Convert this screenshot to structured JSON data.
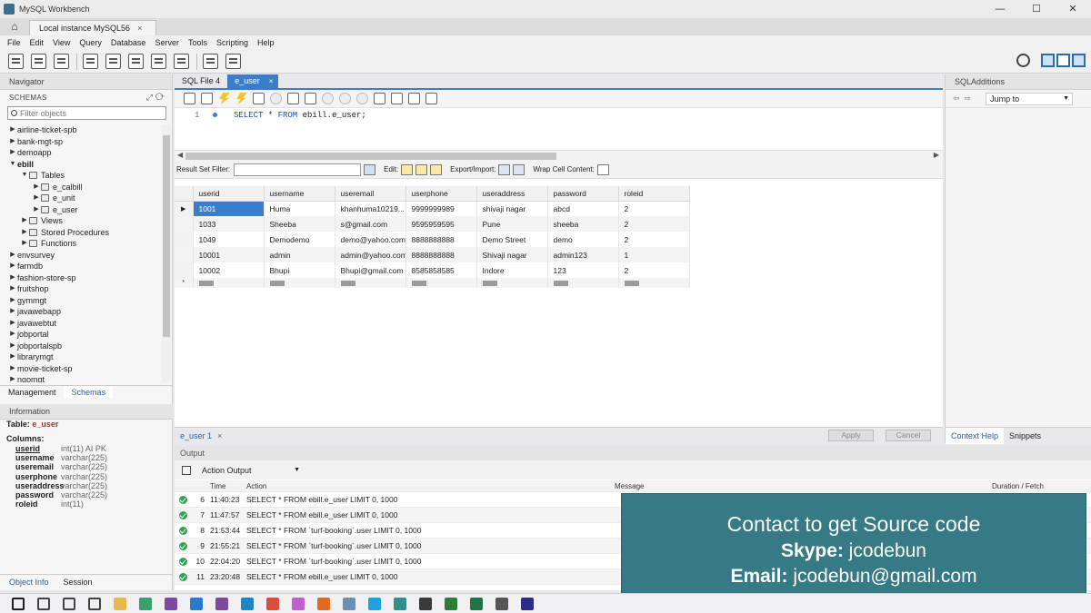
{
  "window": {
    "title": "MySQL Workbench",
    "minimize": "—",
    "maximize": "☐",
    "close": "✕"
  },
  "connection_tab": {
    "home": "⌂",
    "label": "Local instance MySQL56",
    "close": "×"
  },
  "menu": [
    "File",
    "Edit",
    "View",
    "Query",
    "Database",
    "Server",
    "Tools",
    "Scripting",
    "Help"
  ],
  "navigator": {
    "title": "Navigator",
    "schemas_label": "SCHEMAS",
    "filter_placeholder": "Filter objects",
    "tree": [
      {
        "label": "airline-ticket-spb",
        "level": 0,
        "expanded": false
      },
      {
        "label": "bank-mgt-sp",
        "level": 0,
        "expanded": false
      },
      {
        "label": "demoapp",
        "level": 0,
        "expanded": false
      },
      {
        "label": "ebill",
        "level": 0,
        "expanded": true,
        "bold": true
      },
      {
        "label": "Tables",
        "level": 1,
        "expanded": true
      },
      {
        "label": "e_calbill",
        "level": 2,
        "expanded": false
      },
      {
        "label": "e_unit",
        "level": 2,
        "expanded": false
      },
      {
        "label": "e_user",
        "level": 2,
        "expanded": false
      },
      {
        "label": "Views",
        "level": 1,
        "expanded": false
      },
      {
        "label": "Stored Procedures",
        "level": 1,
        "expanded": false
      },
      {
        "label": "Functions",
        "level": 1,
        "expanded": false
      },
      {
        "label": "envsurvey",
        "level": 0,
        "expanded": false
      },
      {
        "label": "farmdb",
        "level": 0,
        "expanded": false
      },
      {
        "label": "fashion-store-sp",
        "level": 0,
        "expanded": false
      },
      {
        "label": "fruitshop",
        "level": 0,
        "expanded": false
      },
      {
        "label": "gymmgt",
        "level": 0,
        "expanded": false
      },
      {
        "label": "javawebapp",
        "level": 0,
        "expanded": false
      },
      {
        "label": "javawebtut",
        "level": 0,
        "expanded": false
      },
      {
        "label": "jobportal",
        "level": 0,
        "expanded": false
      },
      {
        "label": "jobportalspb",
        "level": 0,
        "expanded": false
      },
      {
        "label": "librarymgt",
        "level": 0,
        "expanded": false
      },
      {
        "label": "movie-ticket-sp",
        "level": 0,
        "expanded": false
      },
      {
        "label": "ngomgt",
        "level": 0,
        "expanded": false
      }
    ],
    "tabs": [
      "Management",
      "Schemas"
    ],
    "active_tab": "Schemas"
  },
  "information": {
    "title": "Information",
    "table_label": "Table:",
    "table_name": "e_user",
    "columns_label": "Columns:",
    "columns": [
      {
        "name": "userid",
        "type": "int(11) AI PK"
      },
      {
        "name": "username",
        "type": "varchar(225)"
      },
      {
        "name": "useremail",
        "type": "varchar(225)"
      },
      {
        "name": "userphone",
        "type": "varchar(225)"
      },
      {
        "name": "useraddress",
        "type": "varchar(225)"
      },
      {
        "name": "password",
        "type": "varchar(225)"
      },
      {
        "name": "roleid",
        "type": "int(11)"
      }
    ],
    "bottom_tabs": [
      "Object Info",
      "Session"
    ]
  },
  "editor": {
    "tabs": [
      {
        "label": "SQL File 4",
        "active": false
      },
      {
        "label": "e_user",
        "active": true,
        "close": "×"
      }
    ],
    "line_number": "1",
    "sql_keyword1": "SELECT",
    "sql_rest1": " * ",
    "sql_keyword2": "FROM",
    "sql_rest2": " ebill.e_user;"
  },
  "result_bar": {
    "filter_label": "Result Set Filter:",
    "edit_label": "Edit:",
    "export_label": "Export/Import:",
    "wrap_label": "Wrap Cell Content:"
  },
  "result_grid": {
    "columns": [
      "userid",
      "username",
      "useremail",
      "userphone",
      "useraddress",
      "password",
      "roleid"
    ],
    "rows": [
      [
        "1001",
        "Huma",
        "khanhuma10219...",
        "9999999989",
        "shivaji nagar",
        "abcd",
        "2"
      ],
      [
        "1033",
        "Sheeba",
        "s@gmail.com",
        "9595959595",
        "Pune",
        "sheeba",
        "2"
      ],
      [
        "1049",
        "Demodemo",
        "demo@yahoo.com",
        "8888888888",
        "Demo Street",
        "demo",
        "2"
      ],
      [
        "10001",
        "admin",
        "admin@yahoo.com",
        "8888888888",
        "Shivaji nagar",
        "admin123",
        "1"
      ],
      [
        "10002",
        "Bhupi",
        "Bhupi@gmail.com",
        "8585858585",
        "Indore",
        "123",
        "2"
      ]
    ],
    "null_badge": "NULL",
    "current_row_marker": "▶",
    "new_row_marker": "*"
  },
  "result_tabs": {
    "label": "e_user 1",
    "close": "×",
    "apply": "Apply",
    "cancel": "Cancel"
  },
  "sql_additions": {
    "title": "SQLAdditions",
    "jump_to": "Jump to",
    "tabs": [
      "Context Help",
      "Snippets"
    ],
    "active_tab": "Context Help"
  },
  "output": {
    "title": "Output",
    "selector": "Action Output",
    "headers": {
      "time": "Time",
      "action": "Action",
      "message": "Message",
      "duration": "Duration / Fetch"
    },
    "rows": [
      {
        "n": "6",
        "time": "11:40:23",
        "action": "SELECT * FROM ebill.e_user LIMIT 0, 1000"
      },
      {
        "n": "7",
        "time": "11:47:57",
        "action": "SELECT * FROM ebill.e_user LIMIT 0, 1000"
      },
      {
        "n": "8",
        "time": "21:53:44",
        "action": "SELECT * FROM `turf-booking`.user LIMIT 0, 1000"
      },
      {
        "n": "9",
        "time": "21:55:21",
        "action": "SELECT * FROM `turf-booking`.user LIMIT 0, 1000"
      },
      {
        "n": "10",
        "time": "22:04:20",
        "action": "SELECT * FROM `turf-booking`.user LIMIT 0, 1000"
      },
      {
        "n": "11",
        "time": "23:20:48",
        "action": "SELECT * FROM ebill.e_user LIMIT 0, 1000"
      }
    ]
  },
  "promo": {
    "line1": "Contact to get Source code",
    "skype_label": "Skype:",
    "skype_value": "jcodebun",
    "email_label": "Email:",
    "email_value": "jcodebun@gmail.com"
  },
  "colors": {
    "accent": "#3a7dc9",
    "promo_bg": "#357a85",
    "ok": "#2da44e",
    "selected_cell": "#3a7dc9"
  },
  "taskbar_icons": [
    "windows-icon",
    "search-icon",
    "task-view-icon",
    "widgets-icon",
    "file-explorer-icon",
    "chrome-green-icon",
    "intellij-icon",
    "vscode-icon",
    "visual-studio-icon",
    "edge-icon",
    "chrome-icon",
    "slack-icon",
    "firefox-icon",
    "notepad-icon",
    "skype-icon",
    "mysql-workbench-icon",
    "app-icon",
    "notepad-plus-icon",
    "excel-icon",
    "settings-icon",
    "eclipse-icon"
  ]
}
